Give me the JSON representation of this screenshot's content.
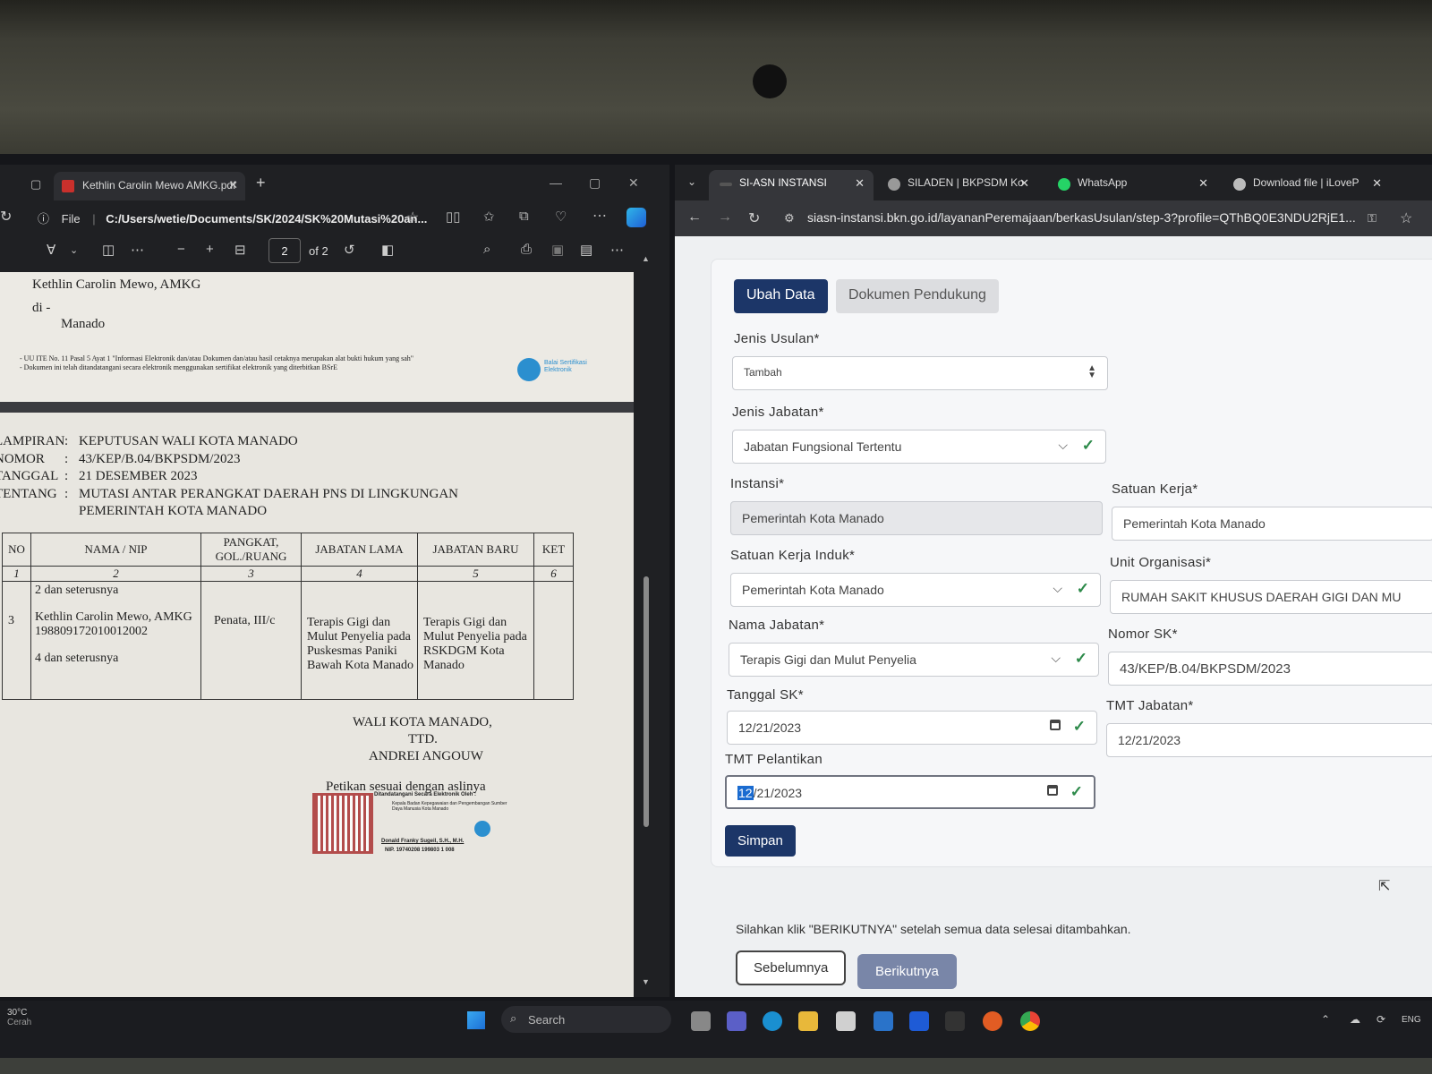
{
  "left_window": {
    "tab_title": "Kethlin Carolin Mewo AMKG.pdf",
    "file_label": "File",
    "address": "C:/Users/wetie/Documents/SK/2024/SK%20Mutasi%20an...",
    "page_current": "2",
    "page_total": "of 2"
  },
  "pdf_page1": {
    "addressee": "Kethlin Carolin Mewo, AMKG",
    "di": "di -",
    "place": "Manado",
    "footnote_1": "- UU ITE No. 11 Pasal 5 Ayat 1 \"Informasi Elektronik dan/atau Dokumen dan/atau hasil cetaknya merupakan alat bukti hukum yang sah\"",
    "footnote_2": "- Dokumen ini telah ditandatangani secara elektronik menggunakan sertifikat elektronik yang diterbitkan BSrE",
    "bsre_logo_text": "Balai Sertifikasi Elektronik"
  },
  "pdf_page2": {
    "meta": [
      {
        "key": "LAMPIRAN",
        "value": "KEPUTUSAN WALI KOTA MANADO"
      },
      {
        "key": "NOMOR",
        "value": "43/KEP/B.04/BKPSDM/2023"
      },
      {
        "key": "TANGGAL",
        "value": "21 DESEMBER 2023"
      },
      {
        "key": "TENTANG",
        "value": "MUTASI ANTAR PERANGKAT DAERAH PNS DI LINGKUNGAN"
      }
    ],
    "meta_continuation": "PEMERINTAH KOTA MANADO",
    "table_headers": [
      "NO",
      "NAMA / NIP",
      "PANGKAT, GOL./RUANG",
      "JABATAN LAMA",
      "JABATAN BARU",
      "KET"
    ],
    "table_numbers": [
      "1",
      "2",
      "3",
      "4",
      "5",
      "6"
    ],
    "row_above": "2 dan seterusnya",
    "row": {
      "no": "3",
      "nama": "Kethlin Carolin Mewo, AMKG",
      "nip": "198809172010012002",
      "pangkat": "Penata, III/c",
      "jabatan_lama": "Terapis Gigi dan Mulut Penyelia pada Puskesmas Paniki Bawah Kota Manado",
      "jabatan_baru": "Terapis Gigi dan Mulut Penyelia pada RSKDGM Kota Manado"
    },
    "row_below": "4 dan seterusnya",
    "signature_title": "WALI KOTA MANADO,",
    "signature_ttd": "TTD.",
    "signature_name": "ANDREI ANGOUW",
    "petikan": "Petikan sesuai dengan aslinya",
    "esign_heading": "Ditandatangani Secara Elektronik Oleh :",
    "esign_office": "Kepala Badan Kepegawaian dan Pengembangan Sumber Daya Manusia Kota Manado",
    "esign_name": "Donald Franky Sugeil, S.H., M.H.",
    "esign_nip": "NIP. 19740208 199803 1 008"
  },
  "right_window": {
    "tabs": [
      {
        "label": "SI-ASN INSTANSI",
        "active": true
      },
      {
        "label": "SILADEN | BKPSDM Ko",
        "active": false
      },
      {
        "label": "WhatsApp",
        "active": false
      },
      {
        "label": "Download file | iLoveP",
        "active": false
      }
    ],
    "url": "siasn-instansi.bkn.go.id/layananPeremajaan/berkasUsulan/step-3?profile=QThBQ0E3NDU2RjE1..."
  },
  "form": {
    "tab_ubah": "Ubah Data",
    "tab_dokumen": "Dokumen Pendukung",
    "jenis_usulan_label": "Jenis Usulan*",
    "jenis_usulan_value": "Tambah",
    "jenis_jabatan_label": "Jenis Jabatan*",
    "jenis_jabatan_value": "Jabatan Fungsional Tertentu",
    "instansi_label": "Instansi*",
    "instansi_value": "Pemerintah Kota Manado",
    "satuan_kerja_label": "Satuan Kerja*",
    "satuan_kerja_value": "Pemerintah Kota Manado",
    "satuan_kerja_induk_label": "Satuan Kerja Induk*",
    "satuan_kerja_induk_value": "Pemerintah Kota Manado",
    "unit_organisasi_label": "Unit Organisasi*",
    "unit_organisasi_value": "RUMAH SAKIT KHUSUS DAERAH GIGI DAN MU",
    "nama_jabatan_label": "Nama Jabatan*",
    "nama_jabatan_value": "Terapis Gigi dan Mulut Penyelia",
    "nomor_sk_label": "Nomor SK*",
    "nomor_sk_value": "43/KEP/B.04/BKPSDM/2023",
    "tanggal_sk_label": "Tanggal SK*",
    "tanggal_sk_value": "12/21/2023",
    "tmt_jabatan_label": "TMT Jabatan*",
    "tmt_jabatan_value": "12/21/2023",
    "tmt_pelantikan_label": "TMT Pelantikan",
    "tmt_pelantikan_month": "12",
    "tmt_pelantikan_rest": "/21/2023",
    "simpan": "Simpan",
    "note": "Silahkan klik \"BERIKUTNYA\" setelah semua data selesai ditambahkan.",
    "sebelumnya": "Sebelumnya",
    "berikutnya": "Berikutnya"
  },
  "taskbar": {
    "search_placeholder": "Search",
    "weather_temp": "30°C",
    "weather_desc": "Cerah",
    "lang": "ENG"
  },
  "colors": {
    "primary": "#1c3668",
    "success": "#2d8a4a",
    "muted_button": "#7986a8"
  }
}
